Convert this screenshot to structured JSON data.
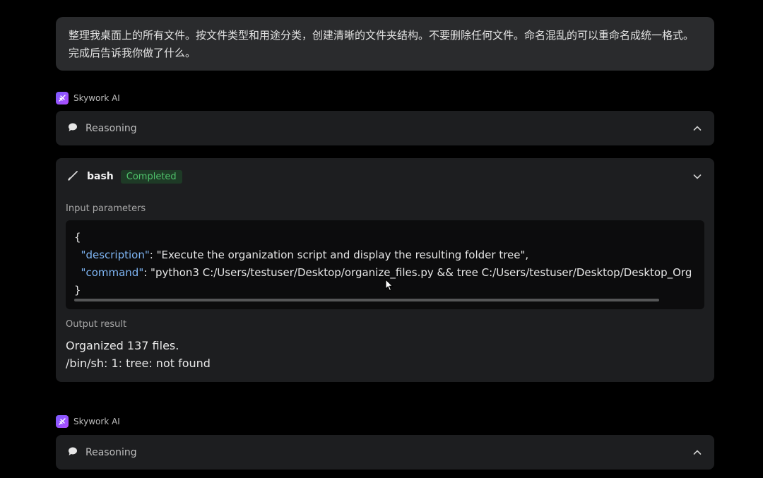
{
  "user_message": {
    "text": "整理我桌面上的所有文件。按文件类型和用途分类，创建清晰的文件夹结构。不要删除任何文件。命名混乱的可以重命名成统一格式。完成后告诉我你做了什么。"
  },
  "agent": {
    "name": "Skywork AI"
  },
  "reasoning": {
    "label": "Reasoning",
    "icon": "speech-bubble-icon"
  },
  "tool_call": {
    "icon": "pen-icon",
    "name": "bash",
    "status": "Completed",
    "input_label": "Input parameters",
    "code": {
      "open_brace": "{",
      "desc_key": "\"description\"",
      "desc_value": "\"Execute the organization script and display the resulting folder tree\",",
      "cmd_key": "\"command\"",
      "cmd_value": "\"python3 C:/Users/testuser/Desktop/organize_files.py && tree C:/Users/testuser/Desktop/Desktop_Org",
      "close_brace": "}"
    },
    "output_label": "Output result",
    "output_lines": [
      "Organized 137 files.",
      "/bin/sh: 1: tree: not found"
    ]
  },
  "colors": {
    "background": "#000000",
    "panel": "#1d1e20",
    "user_bubble": "#2a2b2d",
    "code_bg": "#0c0c0d",
    "json_key": "#7fb6f5",
    "status_green": "#4fc26b",
    "agent_logo": "#8b5cf6"
  }
}
